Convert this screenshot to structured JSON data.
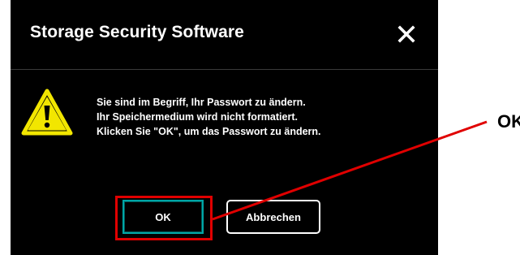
{
  "dialog": {
    "title": "Storage Security Software",
    "close_icon": "close-icon",
    "warning_icon": "warning-triangle-icon",
    "message_lines": [
      "Sie sind im Begriff, Ihr Passwort zu ändern.",
      "Ihr Speichermedium wird nicht formatiert.",
      "Klicken Sie \"OK\", um das Passwort zu ändern."
    ],
    "buttons": {
      "ok_label": "OK",
      "cancel_label": "Abbrechen"
    }
  },
  "annotation": {
    "callout_label": "OK",
    "highlight_color": "#e00000"
  },
  "colors": {
    "dialog_bg": "#000000",
    "text": "#ffffff",
    "ok_border": "#00a6a6",
    "warning_fill": "#f2e600"
  }
}
